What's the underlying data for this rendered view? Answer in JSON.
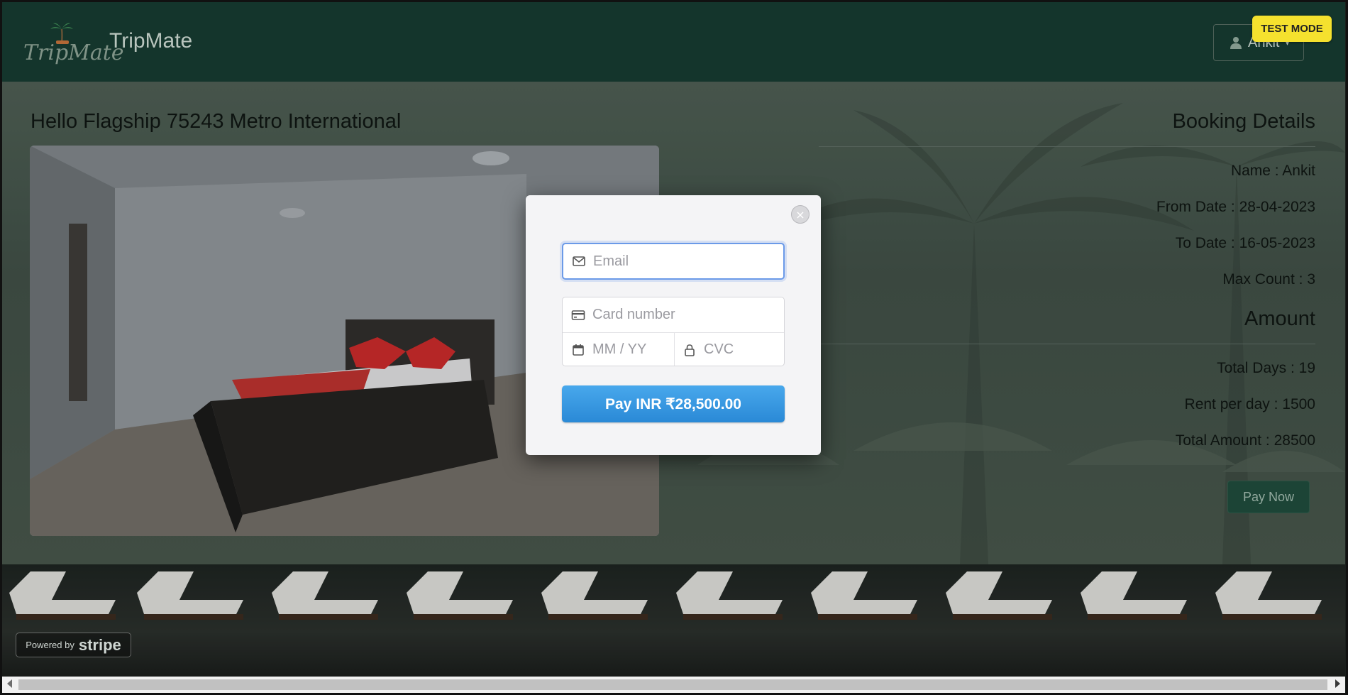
{
  "navbar": {
    "logo_text": "TripMate",
    "brand": "TripMate",
    "user_label": "Ankit"
  },
  "hotel": {
    "title": "Hello Flagship 75243 Metro International"
  },
  "booking": {
    "heading": "Booking Details",
    "name": "Name : Ankit",
    "from_date": "From Date : 28-04-2023",
    "to_date": "To Date : 16-05-2023",
    "max_count": "Max Count : 3",
    "amount_heading": "Amount",
    "total_days": "Total Days : 19",
    "rent_per_day": "Rent per day : 1500",
    "total_amount": "Total Amount : 28500",
    "pay_now": "Pay Now"
  },
  "stripe": {
    "test_mode": "TEST MODE",
    "email_placeholder": "Email",
    "card_placeholder": "Card number",
    "expiry_placeholder": "MM / YY",
    "cvc_placeholder": "CVC",
    "pay_button": "Pay INR ₹28,500.00",
    "powered_by": "Powered by",
    "stripe_word": "stripe",
    "accent": "#2f8fdc"
  },
  "icons": {
    "email": "envelope-icon",
    "card": "credit-card-icon",
    "expiry": "calendar-icon",
    "cvc": "lock-icon",
    "close": "close-icon",
    "user": "person-icon"
  }
}
